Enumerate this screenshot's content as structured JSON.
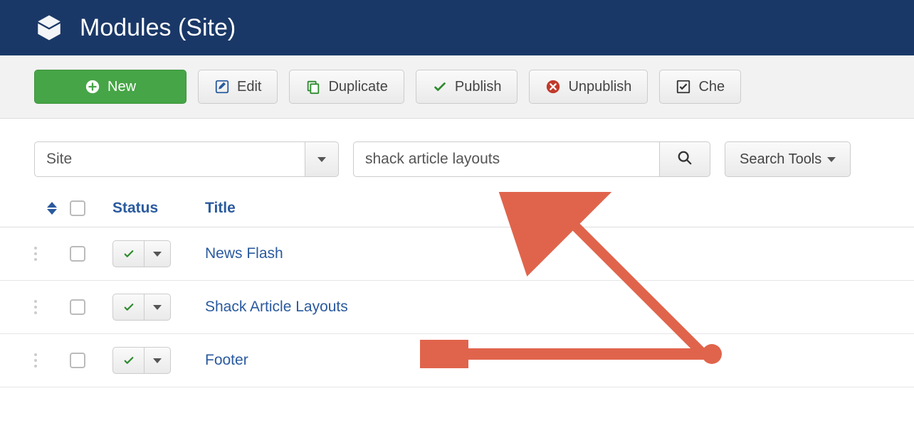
{
  "header": {
    "title": "Modules (Site)"
  },
  "toolbar": {
    "new_label": "New",
    "edit_label": "Edit",
    "duplicate_label": "Duplicate",
    "publish_label": "Publish",
    "unpublish_label": "Unpublish",
    "check_label": "Che"
  },
  "filters": {
    "client_select": "Site",
    "search_value": "shack article layouts",
    "search_tools_label": "Search Tools"
  },
  "columns": {
    "status": "Status",
    "title": "Title"
  },
  "rows": [
    {
      "title": "News Flash"
    },
    {
      "title": "Shack Article Layouts"
    },
    {
      "title": "Footer"
    }
  ]
}
